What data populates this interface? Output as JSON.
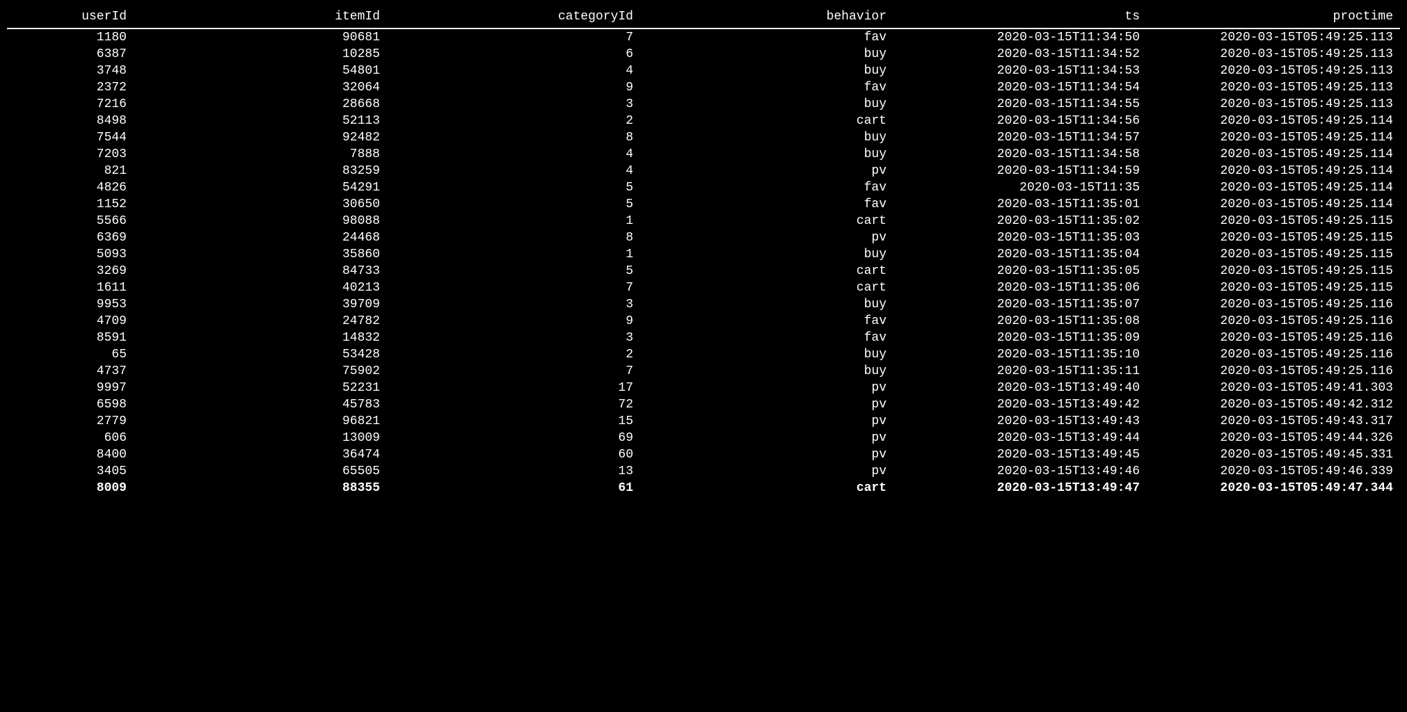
{
  "table": {
    "columns": [
      "userId",
      "itemId",
      "categoryId",
      "behavior",
      "ts",
      "proctime"
    ],
    "rows": [
      {
        "userId": "1180",
        "itemId": "90681",
        "categoryId": "7",
        "behavior": "fav",
        "ts": "2020-03-15T11:34:50",
        "proctime": "2020-03-15T05:49:25.113",
        "highlight": false
      },
      {
        "userId": "6387",
        "itemId": "10285",
        "categoryId": "6",
        "behavior": "buy",
        "ts": "2020-03-15T11:34:52",
        "proctime": "2020-03-15T05:49:25.113",
        "highlight": false
      },
      {
        "userId": "3748",
        "itemId": "54801",
        "categoryId": "4",
        "behavior": "buy",
        "ts": "2020-03-15T11:34:53",
        "proctime": "2020-03-15T05:49:25.113",
        "highlight": false
      },
      {
        "userId": "2372",
        "itemId": "32064",
        "categoryId": "9",
        "behavior": "fav",
        "ts": "2020-03-15T11:34:54",
        "proctime": "2020-03-15T05:49:25.113",
        "highlight": false
      },
      {
        "userId": "7216",
        "itemId": "28668",
        "categoryId": "3",
        "behavior": "buy",
        "ts": "2020-03-15T11:34:55",
        "proctime": "2020-03-15T05:49:25.113",
        "highlight": false
      },
      {
        "userId": "8498",
        "itemId": "52113",
        "categoryId": "2",
        "behavior": "cart",
        "ts": "2020-03-15T11:34:56",
        "proctime": "2020-03-15T05:49:25.114",
        "highlight": false
      },
      {
        "userId": "7544",
        "itemId": "92482",
        "categoryId": "8",
        "behavior": "buy",
        "ts": "2020-03-15T11:34:57",
        "proctime": "2020-03-15T05:49:25.114",
        "highlight": false
      },
      {
        "userId": "7203",
        "itemId": "7888",
        "categoryId": "4",
        "behavior": "buy",
        "ts": "2020-03-15T11:34:58",
        "proctime": "2020-03-15T05:49:25.114",
        "highlight": false
      },
      {
        "userId": "821",
        "itemId": "83259",
        "categoryId": "4",
        "behavior": "pv",
        "ts": "2020-03-15T11:34:59",
        "proctime": "2020-03-15T05:49:25.114",
        "highlight": false
      },
      {
        "userId": "4826",
        "itemId": "54291",
        "categoryId": "5",
        "behavior": "fav",
        "ts": "2020-03-15T11:35",
        "proctime": "2020-03-15T05:49:25.114",
        "highlight": false
      },
      {
        "userId": "1152",
        "itemId": "30650",
        "categoryId": "5",
        "behavior": "fav",
        "ts": "2020-03-15T11:35:01",
        "proctime": "2020-03-15T05:49:25.114",
        "highlight": false
      },
      {
        "userId": "5566",
        "itemId": "98088",
        "categoryId": "1",
        "behavior": "cart",
        "ts": "2020-03-15T11:35:02",
        "proctime": "2020-03-15T05:49:25.115",
        "highlight": false
      },
      {
        "userId": "6369",
        "itemId": "24468",
        "categoryId": "8",
        "behavior": "pv",
        "ts": "2020-03-15T11:35:03",
        "proctime": "2020-03-15T05:49:25.115",
        "highlight": false
      },
      {
        "userId": "5093",
        "itemId": "35860",
        "categoryId": "1",
        "behavior": "buy",
        "ts": "2020-03-15T11:35:04",
        "proctime": "2020-03-15T05:49:25.115",
        "highlight": false
      },
      {
        "userId": "3269",
        "itemId": "84733",
        "categoryId": "5",
        "behavior": "cart",
        "ts": "2020-03-15T11:35:05",
        "proctime": "2020-03-15T05:49:25.115",
        "highlight": false
      },
      {
        "userId": "1611",
        "itemId": "40213",
        "categoryId": "7",
        "behavior": "cart",
        "ts": "2020-03-15T11:35:06",
        "proctime": "2020-03-15T05:49:25.115",
        "highlight": false
      },
      {
        "userId": "9953",
        "itemId": "39709",
        "categoryId": "3",
        "behavior": "buy",
        "ts": "2020-03-15T11:35:07",
        "proctime": "2020-03-15T05:49:25.116",
        "highlight": false
      },
      {
        "userId": "4709",
        "itemId": "24782",
        "categoryId": "9",
        "behavior": "fav",
        "ts": "2020-03-15T11:35:08",
        "proctime": "2020-03-15T05:49:25.116",
        "highlight": false
      },
      {
        "userId": "8591",
        "itemId": "14832",
        "categoryId": "3",
        "behavior": "fav",
        "ts": "2020-03-15T11:35:09",
        "proctime": "2020-03-15T05:49:25.116",
        "highlight": false
      },
      {
        "userId": "65",
        "itemId": "53428",
        "categoryId": "2",
        "behavior": "buy",
        "ts": "2020-03-15T11:35:10",
        "proctime": "2020-03-15T05:49:25.116",
        "highlight": false
      },
      {
        "userId": "4737",
        "itemId": "75902",
        "categoryId": "7",
        "behavior": "buy",
        "ts": "2020-03-15T11:35:11",
        "proctime": "2020-03-15T05:49:25.116",
        "highlight": false
      },
      {
        "userId": "9997",
        "itemId": "52231",
        "categoryId": "17",
        "behavior": "pv",
        "ts": "2020-03-15T13:49:40",
        "proctime": "2020-03-15T05:49:41.303",
        "highlight": false
      },
      {
        "userId": "6598",
        "itemId": "45783",
        "categoryId": "72",
        "behavior": "pv",
        "ts": "2020-03-15T13:49:42",
        "proctime": "2020-03-15T05:49:42.312",
        "highlight": false
      },
      {
        "userId": "2779",
        "itemId": "96821",
        "categoryId": "15",
        "behavior": "pv",
        "ts": "2020-03-15T13:49:43",
        "proctime": "2020-03-15T05:49:43.317",
        "highlight": false
      },
      {
        "userId": "606",
        "itemId": "13009",
        "categoryId": "69",
        "behavior": "pv",
        "ts": "2020-03-15T13:49:44",
        "proctime": "2020-03-15T05:49:44.326",
        "highlight": false
      },
      {
        "userId": "8400",
        "itemId": "36474",
        "categoryId": "60",
        "behavior": "pv",
        "ts": "2020-03-15T13:49:45",
        "proctime": "2020-03-15T05:49:45.331",
        "highlight": false
      },
      {
        "userId": "3405",
        "itemId": "65505",
        "categoryId": "13",
        "behavior": "pv",
        "ts": "2020-03-15T13:49:46",
        "proctime": "2020-03-15T05:49:46.339",
        "highlight": false
      },
      {
        "userId": "8009",
        "itemId": "88355",
        "categoryId": "61",
        "behavior": "cart",
        "ts": "2020-03-15T13:49:47",
        "proctime": "2020-03-15T05:49:47.344",
        "highlight": true
      }
    ]
  }
}
